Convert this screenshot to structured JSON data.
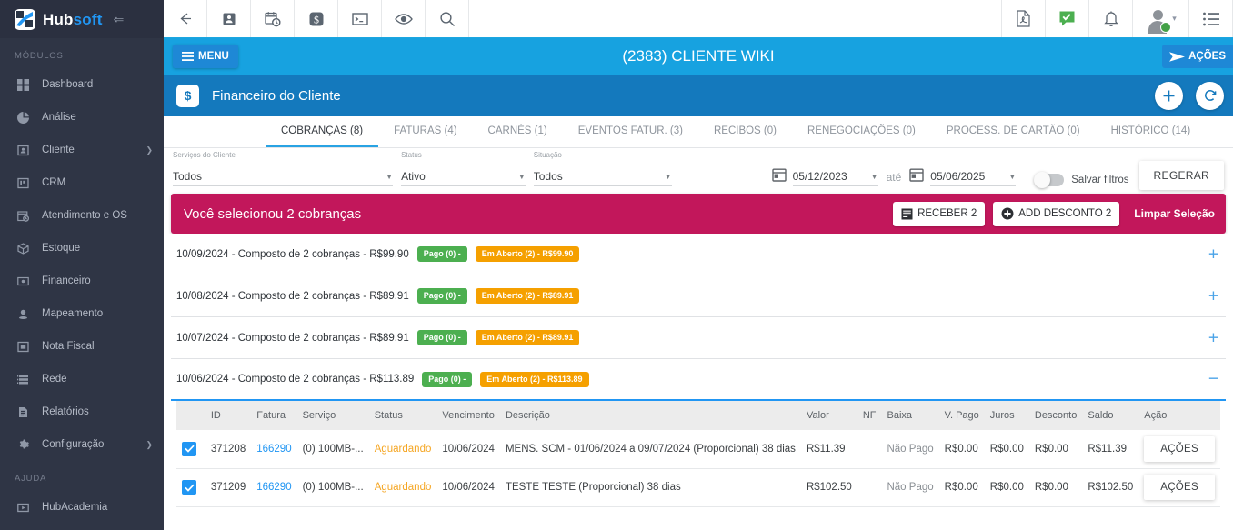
{
  "brand": {
    "name_part1": "Hub",
    "name_part2": "soft",
    "collapse_icon": "collapse-icon"
  },
  "sidebar": {
    "section_modules": "MÓDULOS",
    "section_help": "AJUDA",
    "items": [
      {
        "label": "Dashboard",
        "icon": "grid-icon",
        "caret": ""
      },
      {
        "label": "Análise",
        "icon": "pie-chart-icon",
        "caret": ""
      },
      {
        "label": "Cliente",
        "icon": "user-card-icon",
        "caret": "❯"
      },
      {
        "label": "CRM",
        "icon": "kanban-icon",
        "caret": ""
      },
      {
        "label": "Atendimento e OS",
        "icon": "calendar-clock-icon",
        "caret": ""
      },
      {
        "label": "Estoque",
        "icon": "box-icon",
        "caret": ""
      },
      {
        "label": "Financeiro",
        "icon": "money-icon",
        "caret": ""
      },
      {
        "label": "Mapeamento",
        "icon": "map-pin-icon",
        "caret": ""
      },
      {
        "label": "Nota Fiscal",
        "icon": "invoice-icon",
        "caret": ""
      },
      {
        "label": "Rede",
        "icon": "network-icon",
        "caret": ""
      },
      {
        "label": "Relatórios",
        "icon": "report-icon",
        "caret": ""
      },
      {
        "label": "Configuração",
        "icon": "gear-icon",
        "caret": "❯"
      }
    ],
    "help_items": [
      {
        "label": "HubAcademia",
        "icon": "video-icon"
      }
    ]
  },
  "topbar": {
    "left_icons": [
      "back-arrow-icon",
      "contact-icon",
      "calendar-clock-icon",
      "money-icon",
      "terminal-icon",
      "eye-icon",
      "search-icon"
    ],
    "right_icons": [
      "pdf-icon",
      "whatsapp-icon",
      "bell-icon"
    ],
    "avatar": "user-avatar",
    "menu": "hamburger-list-icon"
  },
  "clientbar": {
    "menu_label": "MENU",
    "title": "(2383) CLIENTE WIKI",
    "actions_label": "AÇÕES"
  },
  "pagebar": {
    "icon": "money-icon",
    "title": "Financeiro do Cliente",
    "add_label": "+",
    "refresh_label": "⟳"
  },
  "tabs": [
    {
      "label": "COBRANÇAS (8)",
      "active": true
    },
    {
      "label": "FATURAS (4)",
      "active": false
    },
    {
      "label": "CARNÊS (1)",
      "active": false
    },
    {
      "label": "EVENTOS FATUR. (3)",
      "active": false
    },
    {
      "label": "RECIBOS (0)",
      "active": false
    },
    {
      "label": "RENEGOCIAÇÕES (0)",
      "active": false
    },
    {
      "label": "PROCESS. DE CARTÃO (0)",
      "active": false
    },
    {
      "label": "HISTÓRICO (14)",
      "active": false
    }
  ],
  "filters": {
    "servicos": {
      "label": "Serviços do Cliente",
      "value": "Todos"
    },
    "status": {
      "label": "Status",
      "value": "Ativo"
    },
    "situacao": {
      "label": "Situação",
      "value": "Todos"
    },
    "date_from": "05/12/2023",
    "date_separator": "até",
    "date_to": "05/06/2025",
    "save_filters_label": "Salvar filtros",
    "regerar_label": "REGERAR"
  },
  "selection": {
    "text": "Você selecionou 2 cobranças",
    "receber_label": "RECEBER 2",
    "desconto_label": "ADD DESCONTO 2",
    "clear_label": "Limpar Seleção"
  },
  "charges": [
    {
      "label": "10/09/2024 - Composto de 2 cobranças - R$99.90",
      "paid_chip": "Pago (0) -",
      "open_chip": "Em Aberto (2) - R$99.90",
      "expander": "+",
      "expanded": false
    },
    {
      "label": "10/08/2024 - Composto de 2 cobranças - R$89.91",
      "paid_chip": "Pago (0) -",
      "open_chip": "Em Aberto (2) - R$89.91",
      "expander": "+",
      "expanded": false
    },
    {
      "label": "10/07/2024 - Composto de 2 cobranças - R$89.91",
      "paid_chip": "Pago (0) -",
      "open_chip": "Em Aberto (2) - R$89.91",
      "expander": "+",
      "expanded": false
    },
    {
      "label": "10/06/2024 - Composto de 2 cobranças - R$113.89",
      "paid_chip": "Pago (0) -",
      "open_chip": "Em Aberto (2) - R$113.89",
      "expander": "−",
      "expanded": true
    }
  ],
  "table": {
    "headers": [
      "",
      "ID",
      "Fatura",
      "Serviço",
      "Status",
      "Vencimento",
      "Descrição",
      "Valor",
      "NF",
      "Baixa",
      "V. Pago",
      "Juros",
      "Desconto",
      "Saldo",
      "Ação"
    ],
    "rows": [
      {
        "checked": true,
        "id": "371208",
        "fatura": "166290",
        "servico": "(0) 100MB-...",
        "status": "Aguardando",
        "vencimento": "10/06/2024",
        "descricao": "MENS. SCM - 01/06/2024 a 09/07/2024 (Proporcional) 38 dias",
        "valor": "R$11.39",
        "nf": "",
        "baixa": "Não Pago",
        "v_pago": "R$0.00",
        "juros": "R$0.00",
        "desconto": "R$0.00",
        "saldo": "R$11.39",
        "acao": "AÇÕES"
      },
      {
        "checked": true,
        "id": "371209",
        "fatura": "166290",
        "servico": "(0) 100MB-...",
        "status": "Aguardando",
        "vencimento": "10/06/2024",
        "descricao": "TESTE TESTE (Proporcional) 38 dias",
        "valor": "R$102.50",
        "nf": "",
        "baixa": "Não Pago",
        "v_pago": "R$0.00",
        "juros": "R$0.00",
        "desconto": "R$0.00",
        "saldo": "R$102.50",
        "acao": "AÇÕES"
      }
    ]
  },
  "colors": {
    "brand_blue": "#2196f3",
    "header_blue": "#17a2e0",
    "page_blue": "#1479bd",
    "selection_pink": "#c2175b",
    "chip_green": "#4caf50",
    "chip_orange": "#f5a000",
    "sidebar_bg": "#2f3545"
  }
}
